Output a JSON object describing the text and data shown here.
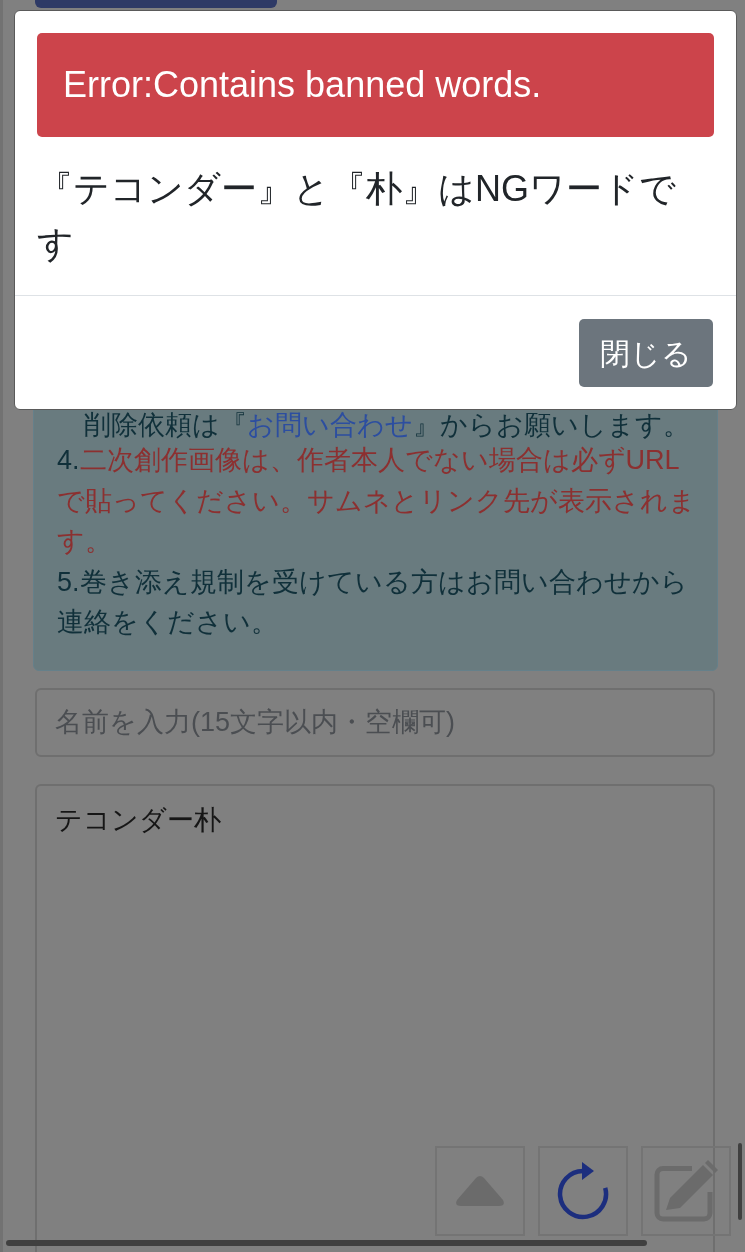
{
  "page": {
    "notice": {
      "lines": [
        {
          "parts": [
            {
              "kind": "plain",
              "text": "　削除依頼は『"
            },
            {
              "kind": "link",
              "text": "お問い合わせ"
            },
            {
              "kind": "plain",
              "text": "』からお願いします。"
            }
          ]
        },
        {
          "parts": [
            {
              "kind": "plain",
              "text": "4."
            },
            {
              "kind": "warning",
              "text": "二次創作画像は、作者本人でない場合は必ずURLで貼ってください。サムネとリンク先が表示されます。"
            }
          ]
        },
        {
          "parts": [
            {
              "kind": "plain",
              "text": "5.巻き添え規制を受けている方はお問い合わせから連絡をください。"
            }
          ]
        }
      ]
    },
    "name_field": {
      "placeholder": "名前を入力(15文字以内・空欄可)"
    },
    "message_field": {
      "value": "テコンダー朴"
    }
  },
  "modal": {
    "alert": "Error:Contains banned words.",
    "message": "『テコンダー』と『朴』はNGワードです",
    "buttons": [
      "閉じる"
    ]
  }
}
